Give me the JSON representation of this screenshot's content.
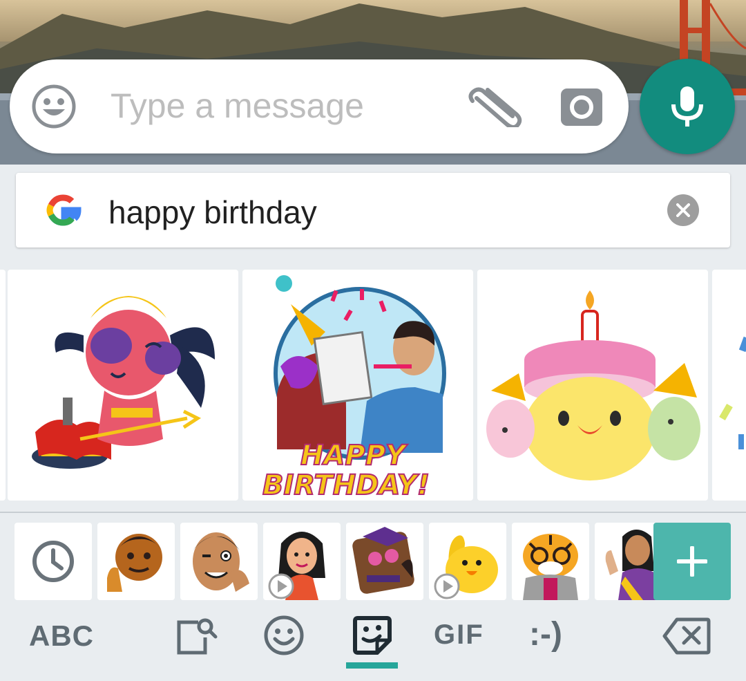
{
  "composer": {
    "placeholder": "Type a message",
    "emoji_icon": "smiley-icon",
    "attach_icon": "paperclip-icon",
    "camera_icon": "camera-icon"
  },
  "mic_button": {
    "icon": "microphone-icon",
    "color": "#128c7e"
  },
  "sticker_search": {
    "logo": "google-g-icon",
    "query": "happy birthday",
    "clear_icon": "clear-icon"
  },
  "results": [
    {
      "name": "sticker-dancing-creature-cake"
    },
    {
      "name": "sticker-happy-birthday-cake-face",
      "text": "HAPPY BIRTHDAY!"
    },
    {
      "name": "sticker-birthday-cake-chicks"
    },
    {
      "name": "sticker-partial"
    }
  ],
  "packs": [
    {
      "name": "recent-stickers",
      "icon": "clock-icon"
    },
    {
      "name": "pack-man-thumbs-up"
    },
    {
      "name": "pack-man-ok-sign"
    },
    {
      "name": "pack-woman-animated",
      "animated": true
    },
    {
      "name": "pack-cool-character"
    },
    {
      "name": "pack-yellow-blob-animated",
      "animated": true
    },
    {
      "name": "pack-tiger-glasses"
    },
    {
      "name": "pack-woman-saree"
    }
  ],
  "add_pack_icon": "plus-icon",
  "bottom_nav": {
    "abc_label": "ABC",
    "gif_label": "GIF",
    "emoticon_label": ":-)",
    "active_tab": "stickers",
    "accent": "#26a69a"
  }
}
